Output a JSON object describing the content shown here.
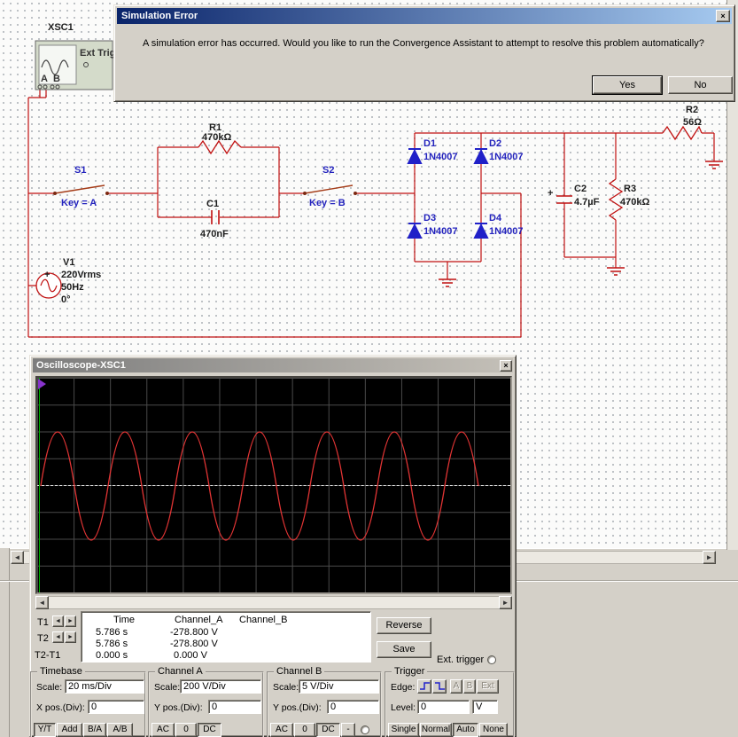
{
  "dialog": {
    "title": "Simulation Error",
    "close": "×",
    "message": "A simulation error has occurred. Would you like to run the Convergence Assistant to attempt to resolve this problem automatically?",
    "yes": "Yes",
    "no": "No"
  },
  "schematic": {
    "xsc1": {
      "ref": "XSC1",
      "ext_trig": "Ext Trig",
      "a": "A",
      "b": "B"
    },
    "r1": {
      "ref": "R1",
      "val": "470kΩ"
    },
    "c1": {
      "ref": "C1",
      "val": "470nF"
    },
    "s1": {
      "ref": "S1",
      "val": "Key = A"
    },
    "s2": {
      "ref": "S2",
      "val": "Key = B"
    },
    "d1": {
      "ref": "D1",
      "val": "1N4007"
    },
    "d2": {
      "ref": "D2",
      "val": "1N4007"
    },
    "d3": {
      "ref": "D3",
      "val": "1N4007"
    },
    "d4": {
      "ref": "D4",
      "val": "1N4007"
    },
    "v1": {
      "ref": "V1",
      "l1": "220Vrms",
      "l2": "50Hz",
      "l3": "0°",
      "plus": "+"
    },
    "r2": {
      "ref": "R2",
      "val": "56Ω"
    },
    "c2": {
      "ref": "C2",
      "val": "4.7µF",
      "plus": "+"
    },
    "r3": {
      "ref": "R3",
      "val": "470kΩ"
    }
  },
  "scope": {
    "title": "Oscilloscope-XSC1",
    "close": "×",
    "readout": {
      "col_time": "Time",
      "col_a": "Channel_A",
      "col_b": "Channel_B",
      "t1_label": "T1",
      "t2_label": "T2",
      "dt_label": "T2-T1",
      "t1_time": "5.786 s",
      "t1_a": "-278.800 V",
      "t2_time": "5.786 s",
      "t2_a": "-278.800 V",
      "dt_time": "0.000 s",
      "dt_a": "0.000 V"
    },
    "reverse": "Reverse",
    "save": "Save",
    "ext_trigger": "Ext. trigger",
    "timebase": {
      "title": "Timebase",
      "scale_label": "Scale:",
      "scale": "20 ms/Div",
      "xpos_label": "X pos.(Div):",
      "xpos": "0",
      "b1": "Y/T",
      "b2": "Add",
      "b3": "B/A",
      "b4": "A/B"
    },
    "cha": {
      "title": "Channel A",
      "scale_label": "Scale:",
      "scale": "200 V/Div",
      "ypos_label": "Y pos.(Div):",
      "ypos": "0",
      "b1": "AC",
      "b2": "0",
      "b3": "DC"
    },
    "chb": {
      "title": "Channel B",
      "scale_label": "Scale:",
      "scale": "5 V/Div",
      "ypos_label": "Y pos.(Div):",
      "ypos": "0",
      "b1": "AC",
      "b2": "0",
      "b3": "DC",
      "b4": "-"
    },
    "trigger": {
      "title": "Trigger",
      "edge_label": "Edge:",
      "a": "A",
      "b": "B",
      "ext": "Ext",
      "level_label": "Level:",
      "level": "0",
      "unit": "V",
      "b1": "Single",
      "b2": "Normal",
      "b3": "Auto",
      "b4": "None"
    }
  },
  "glyphs": {
    "left": "◄",
    "right": "►"
  }
}
